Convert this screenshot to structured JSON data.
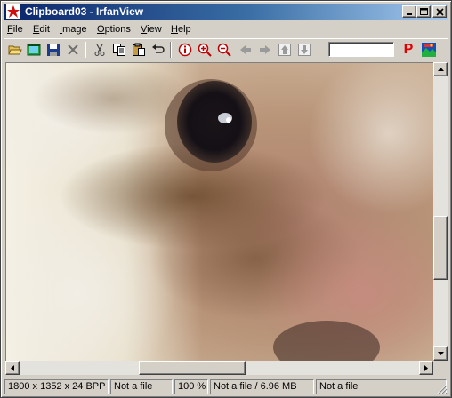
{
  "window": {
    "title": "Clipboard03 - IrfanView",
    "controls": {
      "minimize_icon": "minimize-icon",
      "maximize_icon": "maximize-icon",
      "close_icon": "close-icon"
    }
  },
  "menu": [
    {
      "label": "File",
      "key": "F",
      "rest": "ile"
    },
    {
      "label": "Edit",
      "key": "E",
      "rest": "dit"
    },
    {
      "label": "Image",
      "key": "I",
      "rest": "mage"
    },
    {
      "label": "Options",
      "key": "O",
      "rest": "ptions"
    },
    {
      "label": "View",
      "key": "V",
      "rest": "iew"
    },
    {
      "label": "Help",
      "key": "H",
      "rest": "elp"
    }
  ],
  "toolbar": {
    "icons": [
      "open-folder-icon",
      "slideshow-icon",
      "save-icon",
      "delete-icon",
      "cut-icon",
      "copy-icon",
      "paste-icon",
      "undo-icon",
      "info-icon",
      "zoom-in-icon",
      "zoom-out-icon",
      "previous-icon",
      "next-icon",
      "first-icon",
      "last-icon",
      "paint-icon",
      "irfanview-logo-icon"
    ],
    "search_value": "",
    "paint_label": "P"
  },
  "image": {
    "subject": "hamster-closeup-photo"
  },
  "scrollbars": {
    "vertical_position": 0.45,
    "horizontal_position": 0.4
  },
  "status": {
    "dimensions": "1800 x 1352 x 24 BPP",
    "file_index": "Not a file",
    "zoom": "100 %",
    "file_size": "Not a file / 6.96 MB",
    "file_date": "Not a file"
  },
  "colors": {
    "title_active": "#0a246a",
    "title_gradient_end": "#a6caf0",
    "chrome": "#d4d0c8",
    "paint_p": "#e00000"
  }
}
